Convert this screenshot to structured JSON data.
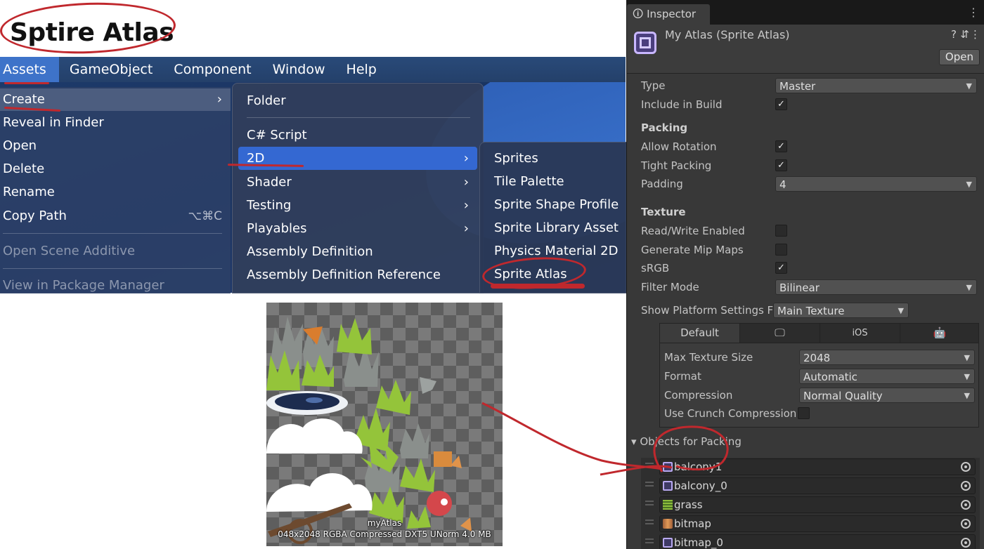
{
  "slide": {
    "title": "Sptire Atlas"
  },
  "menubar": {
    "items": [
      "Assets",
      "GameObject",
      "Component",
      "Window",
      "Help"
    ]
  },
  "assets_menu": {
    "items": [
      {
        "label": "Create",
        "submenu": true
      },
      {
        "label": "Reveal in Finder"
      },
      {
        "label": "Open"
      },
      {
        "label": "Delete"
      },
      {
        "label": "Rename"
      },
      {
        "label": "Copy Path",
        "shortcut": "⌥⌘C"
      },
      {
        "label": "Open Scene Additive",
        "disabled": true
      },
      {
        "label": "View in Package Manager",
        "disabled": true
      }
    ]
  },
  "create_menu": {
    "items": [
      {
        "label": "Folder"
      },
      {
        "label": "C# Script"
      },
      {
        "label": "2D",
        "submenu": true
      },
      {
        "label": "Shader",
        "submenu": true
      },
      {
        "label": "Testing",
        "submenu": true
      },
      {
        "label": "Playables",
        "submenu": true
      },
      {
        "label": "Assembly Definition"
      },
      {
        "label": "Assembly Definition Reference"
      }
    ]
  },
  "twod_menu": {
    "items": [
      "Sprites",
      "Tile Palette",
      "Sprite Shape Profile",
      "Sprite Library Asset",
      "Physics Material 2D",
      "Sprite Atlas"
    ]
  },
  "atlas_preview": {
    "name": "myAtlas",
    "info": "048x2048 RGBA Compressed DXT5 UNorm   4.0 MB"
  },
  "inspector": {
    "tab_label": "Inspector",
    "asset_title": "My Atlas (Sprite Atlas)",
    "open_button": "Open",
    "type_label": "Type",
    "type_value": "Master",
    "include_in_build_label": "Include in Build",
    "include_in_build": true,
    "packing_header": "Packing",
    "allow_rotation_label": "Allow Rotation",
    "allow_rotation": true,
    "tight_packing_label": "Tight Packing",
    "tight_packing": true,
    "padding_label": "Padding",
    "padding_value": "4",
    "texture_header": "Texture",
    "read_write_label": "Read/Write Enabled",
    "read_write": false,
    "mipmaps_label": "Generate Mip Maps",
    "mipmaps": false,
    "srgb_label": "sRGB",
    "srgb": true,
    "filter_mode_label": "Filter Mode",
    "filter_mode_value": "Bilinear",
    "platform_settings_label": "Show Platform Settings F",
    "platform_settings_value": "Main Texture",
    "platform_tabs": {
      "default": "Default",
      "ios": "iOS"
    },
    "max_texture_size_label": "Max Texture Size",
    "max_texture_size_value": "2048",
    "format_label": "Format",
    "format_value": "Automatic",
    "compression_label": "Compression",
    "compression_value": "Normal Quality",
    "crunch_label": "Use Crunch Compression",
    "crunch": false,
    "objects_for_packing_label": "Objects for Packing",
    "objects_for_packing": [
      {
        "name": "balcony1",
        "icon": "sprite-icon"
      },
      {
        "name": "balcony_0",
        "icon": "sprite-icon"
      },
      {
        "name": "grass",
        "icon": "texture-grass-icon"
      },
      {
        "name": "bitmap",
        "icon": "texture-bitmap-icon"
      },
      {
        "name": "bitmap_0",
        "icon": "sprite-icon"
      }
    ]
  },
  "colors": {
    "annotation_red": "#c0282d",
    "menu_highlight": "#3468d2",
    "inspector_bg": "#383838"
  }
}
